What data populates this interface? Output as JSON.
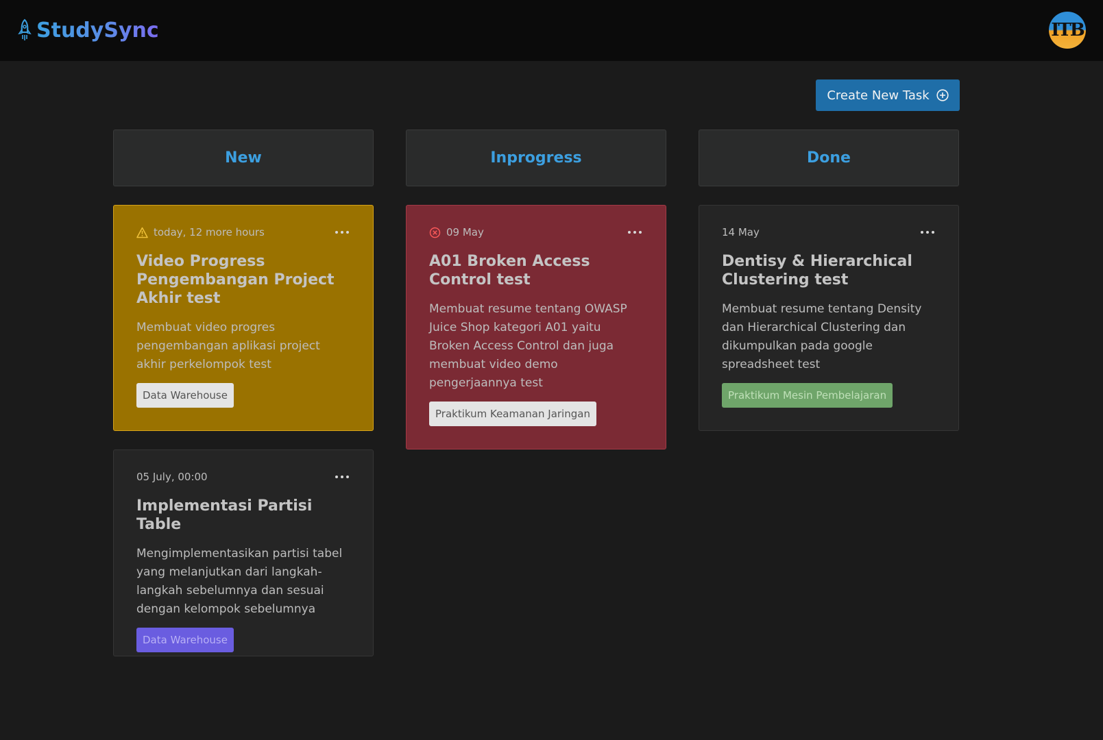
{
  "app": {
    "name": "StudySync",
    "avatar_text": "ITB"
  },
  "toolbar": {
    "create_label": "Create New Task"
  },
  "columns": [
    {
      "title": "New"
    },
    {
      "title": "Inprogress"
    },
    {
      "title": "Done"
    }
  ],
  "cards": {
    "new_1": {
      "due": "today, 12 more hours",
      "due_status": "warning",
      "title": "Video Progress Pengembangan Project Akhir test",
      "description": "Membuat video progres pengembangan aplikasi project akhir perkelompok test",
      "tag": "Data Warehouse",
      "color": "#9a7200"
    },
    "new_2": {
      "due": "05 July, 00:00",
      "title": "Implementasi Partisi Table",
      "description": "Mengimplementasikan partisi tabel yang melanjutkan dari langkah-langkah sebelumnya dan sesuai dengan kelompok sebelumnya",
      "tag": "Data Warehouse",
      "tag_color": "#6a5de0"
    },
    "inprogress_1": {
      "due": "09 May",
      "due_status": "overdue",
      "title": "A01 Broken Access Control test",
      "description": "Membuat resume tentang OWASP Juice Shop kategori A01 yaitu Broken Access Control dan juga membuat video demo pengerjaannya test",
      "tag": "Praktikum Keamanan Jaringan",
      "color": "#7b2a34"
    },
    "done_1": {
      "due": "14 May",
      "title": "Dentisy & Hierarchical Clustering test",
      "description": "Membuat resume tentang Density dan Hierarchical Clustering dan dikumpulkan pada google spreadsheet test",
      "tag": "Praktikum Mesin Pembelajaran",
      "tag_color": "#6fa56a"
    }
  },
  "colors": {
    "accent": "#3c9fe0",
    "button": "#1f6ea8",
    "background": "#1b1b1b"
  }
}
